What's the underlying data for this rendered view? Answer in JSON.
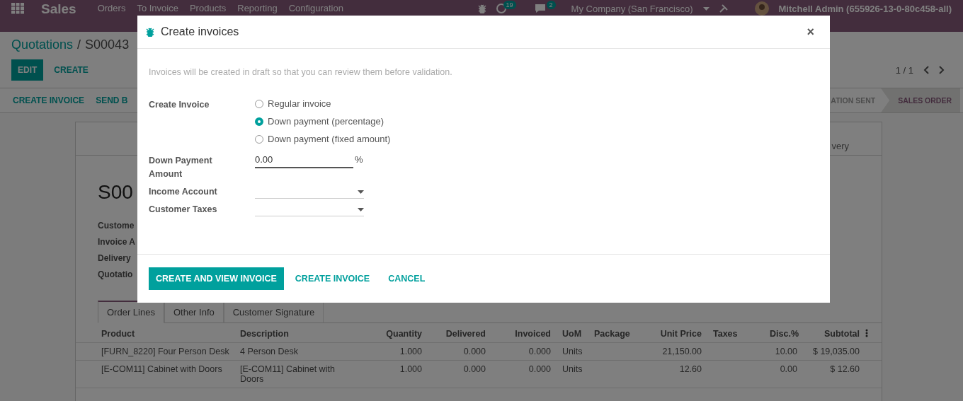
{
  "navbar": {
    "app": "Sales",
    "menus": [
      "Orders",
      "To Invoice",
      "Products",
      "Reporting",
      "Configuration"
    ],
    "activity_count": "19",
    "message_count": "2",
    "company": "My Company (San Francisco)",
    "user": "Mitchell Admin (655926-13-0-80c458-all)"
  },
  "breadcrumb": {
    "parent": "Quotations",
    "separator": "/",
    "current": "S00043"
  },
  "actions": [
    {
      "label": "EDIT",
      "kind": "primary"
    },
    {
      "label": "CREATE",
      "kind": "link"
    }
  ],
  "pager": {
    "value": "1 / 1"
  },
  "status_bar": {
    "buttons": [
      "CREATE INVOICE",
      "SEND B"
    ],
    "stages": [
      {
        "label": "ATION SENT",
        "selected": false
      },
      {
        "label": "SALES ORDER",
        "selected": true
      }
    ]
  },
  "sheet": {
    "smart_button": "very",
    "title": "S00",
    "fields": [
      "Custome",
      "Invoice A",
      "Delivery",
      "Quotatio"
    ]
  },
  "tabs": [
    {
      "label": "Order Lines",
      "selected": true
    },
    {
      "label": "Other Info",
      "selected": false
    },
    {
      "label": "Customer Signature",
      "selected": false
    }
  ],
  "table": {
    "columns": [
      "Product",
      "Description",
      "Quantity",
      "Delivered",
      "Invoiced",
      "UoM",
      "Package",
      "Unit Price",
      "Taxes",
      "Disc.%",
      "Subtotal"
    ],
    "rows": [
      [
        "[FURN_8220] Four Person Desk",
        "4 Person Desk",
        "1.000",
        "0.000",
        "0.000",
        "Units",
        "",
        "21,150.00",
        "",
        "10.00",
        "$ 19,035.00"
      ],
      [
        "[E-COM11] Cabinet with Doors",
        "[E-COM11] Cabinet with Doors",
        "1.000",
        "0.000",
        "0.000",
        "Units",
        "",
        "12.60",
        "",
        "0.00",
        "$ 12.60"
      ]
    ]
  },
  "dialog": {
    "title": "Create invoices",
    "close": "×",
    "note": "Invoices will be created in draft so that you can review them before validation.",
    "fields": [
      {
        "kind": "radio",
        "label": "Create Invoice",
        "options": [
          {
            "label": "Regular invoice",
            "selected": false
          },
          {
            "label": "Down payment (percentage)",
            "selected": true
          },
          {
            "label": "Down payment (fixed amount)",
            "selected": false
          }
        ]
      },
      {
        "kind": "input",
        "label": "Down Payment Amount",
        "value": "0.00",
        "suffix": "%"
      },
      {
        "kind": "select",
        "label": "Income Account"
      },
      {
        "kind": "select",
        "label": "Customer Taxes"
      }
    ],
    "buttons": [
      {
        "label": "CREATE AND VIEW INVOICE",
        "kind": "primary"
      },
      {
        "label": "CREATE INVOICE",
        "kind": "link"
      },
      {
        "label": "CANCEL",
        "kind": "link"
      }
    ]
  }
}
